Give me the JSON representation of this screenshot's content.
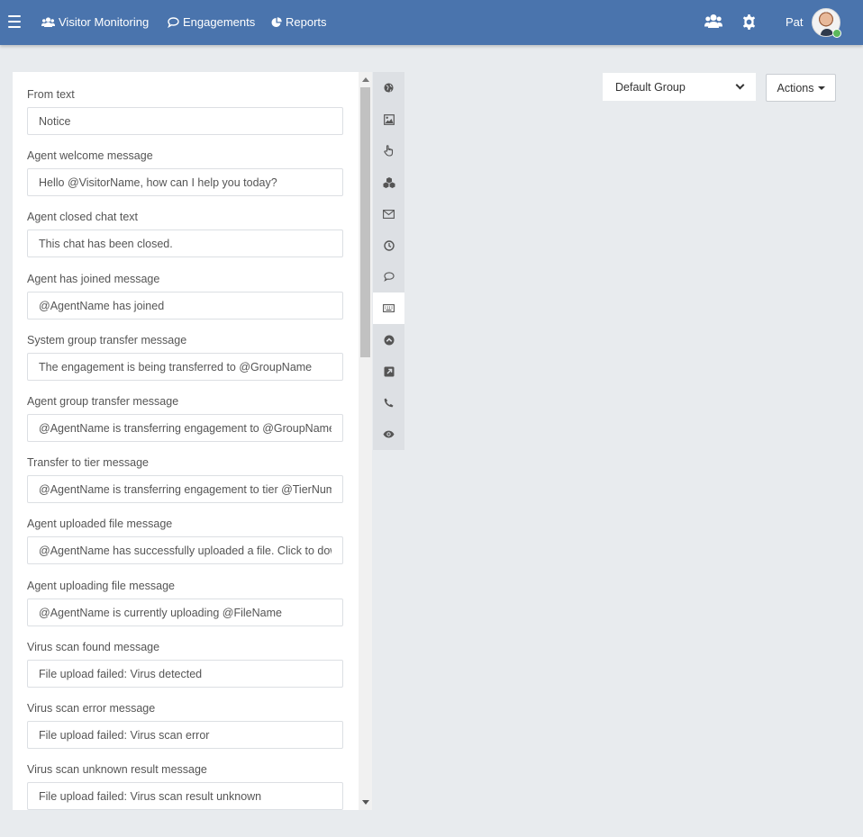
{
  "navbar": {
    "visitor_monitoring": "Visitor Monitoring",
    "engagements": "Engagements",
    "reports": "Reports",
    "user_name": "Pat"
  },
  "fields": [
    {
      "label": "From text",
      "value": "Notice"
    },
    {
      "label": "Agent welcome message",
      "value": "Hello @VisitorName, how can I help you today?"
    },
    {
      "label": "Agent closed chat text",
      "value": "This chat has been closed."
    },
    {
      "label": "Agent has joined message",
      "value": "@AgentName has joined"
    },
    {
      "label": "System group transfer message",
      "value": "The engagement is being transferred to @GroupName"
    },
    {
      "label": "Agent group transfer message",
      "value": "@AgentName is transferring engagement to @GroupName"
    },
    {
      "label": "Transfer to tier message",
      "value": "@AgentName is transferring engagement to tier @TierNumber"
    },
    {
      "label": "Agent uploaded file message",
      "value": "@AgentName has successfully uploaded a file. Click to download"
    },
    {
      "label": "Agent uploading file message",
      "value": "@AgentName is currently uploading @FileName"
    },
    {
      "label": "Virus scan found message",
      "value": "File upload failed: Virus detected"
    },
    {
      "label": "Virus scan error message",
      "value": "File upload failed: Virus scan error"
    },
    {
      "label": "Virus scan unknown result message",
      "value": "File upload failed: Virus scan result unknown"
    }
  ],
  "tabs": [
    {
      "icon": "globe-icon"
    },
    {
      "icon": "image-icon"
    },
    {
      "icon": "hand-pointer-icon"
    },
    {
      "icon": "cubes-icon"
    },
    {
      "icon": "envelope-icon"
    },
    {
      "icon": "clock-icon"
    },
    {
      "icon": "comment-icon"
    },
    {
      "icon": "keyboard-icon",
      "active": true
    },
    {
      "icon": "chevron-circle-up-icon"
    },
    {
      "icon": "external-link-square-icon"
    },
    {
      "icon": "phone-icon"
    },
    {
      "icon": "eye-icon"
    }
  ],
  "group_select": {
    "selected": "Default Group"
  },
  "actions": {
    "label": "Actions"
  },
  "colors": {
    "navbar": "#4a74ad",
    "background": "#e8ebee",
    "online": "#5cb85c"
  }
}
